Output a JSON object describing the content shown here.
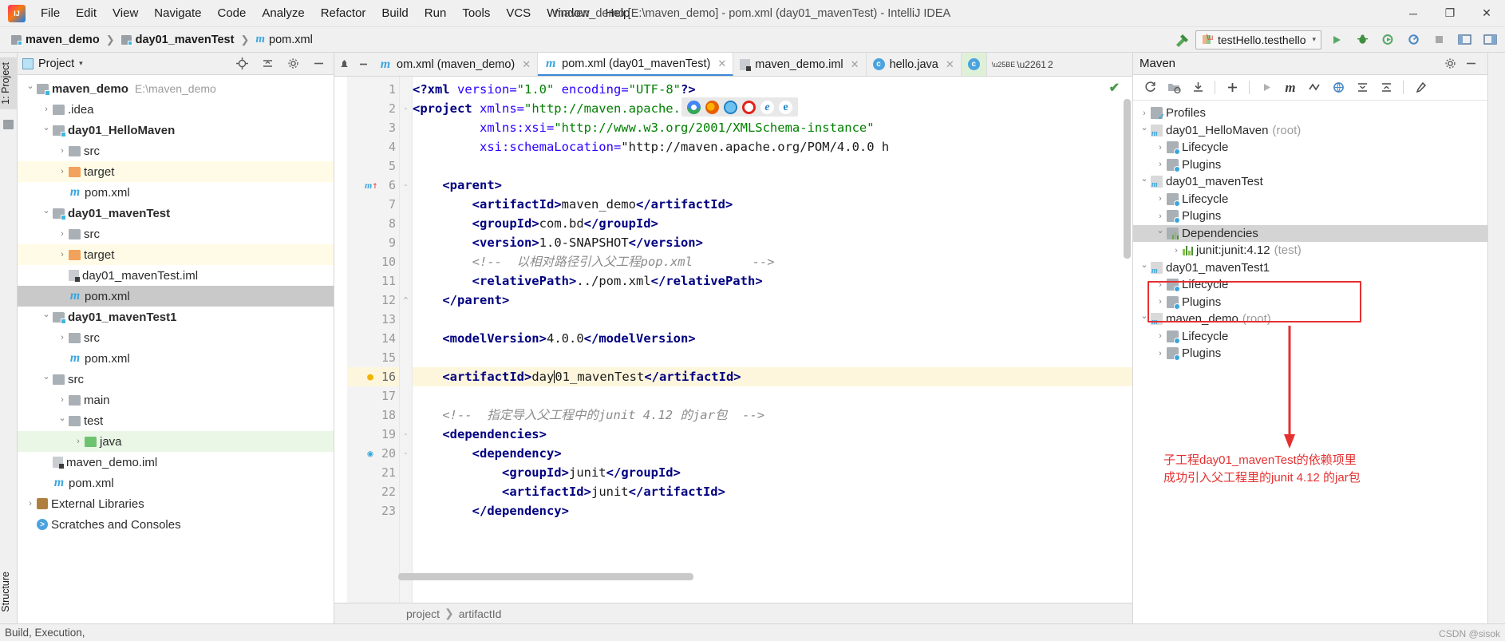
{
  "titlebar": {
    "logo": "intellij-logo",
    "menus": [
      "File",
      "Edit",
      "View",
      "Navigate",
      "Code",
      "Analyze",
      "Refactor",
      "Build",
      "Run",
      "Tools",
      "VCS",
      "Window",
      "Help"
    ],
    "window_title": "maven_demo [E:\\maven_demo] - pom.xml (day01_mavenTest) - IntelliJ IDEA",
    "minimize": "─",
    "maximize": "❐",
    "close": "✕"
  },
  "navbar": {
    "breadcrumb": [
      "maven_demo",
      "day01_mavenTest",
      "pom.xml"
    ],
    "separator": "❯",
    "run_config": "testHello.testhello",
    "run_config_chevron": "▾",
    "buttons": [
      "run",
      "debug",
      "run-with-coverage",
      "profile",
      "stop",
      "ui-inspector",
      "layout"
    ]
  },
  "left_rail": {
    "project_tab": "1: Project",
    "structure_tab": "Structure"
  },
  "project_panel": {
    "title": "Project",
    "title_chevron": "▾",
    "toolbar_icons": [
      "locate-icon",
      "collapse-all-icon",
      "settings-icon",
      "hide-icon"
    ],
    "tree": [
      {
        "depth": 0,
        "arrow": "open",
        "icon": "module",
        "label": "maven_demo",
        "bold": true,
        "path": "E:\\maven_demo",
        "hl": "none"
      },
      {
        "depth": 1,
        "arrow": "closed",
        "icon": "folder",
        "label": ".idea",
        "bold": false,
        "hl": "none"
      },
      {
        "depth": 1,
        "arrow": "open",
        "icon": "module",
        "label": "day01_HelloMaven",
        "bold": true,
        "hl": "none"
      },
      {
        "depth": 2,
        "arrow": "closed",
        "icon": "folder",
        "label": "src",
        "bold": false,
        "hl": "none"
      },
      {
        "depth": 2,
        "arrow": "closed",
        "icon": "folder-orange",
        "label": "target",
        "bold": false,
        "hl": "yellow"
      },
      {
        "depth": 2,
        "arrow": "none",
        "icon": "maven",
        "label": "pom.xml",
        "bold": false,
        "hl": "none"
      },
      {
        "depth": 1,
        "arrow": "open",
        "icon": "module",
        "label": "day01_mavenTest",
        "bold": true,
        "hl": "none"
      },
      {
        "depth": 2,
        "arrow": "closed",
        "icon": "folder",
        "label": "src",
        "bold": false,
        "hl": "none"
      },
      {
        "depth": 2,
        "arrow": "closed",
        "icon": "folder-orange",
        "label": "target",
        "bold": false,
        "hl": "yellow"
      },
      {
        "depth": 2,
        "arrow": "none",
        "icon": "iml",
        "label": "day01_mavenTest.iml",
        "bold": false,
        "hl": "none"
      },
      {
        "depth": 2,
        "arrow": "none",
        "icon": "maven",
        "label": "pom.xml",
        "bold": false,
        "hl": "gray"
      },
      {
        "depth": 1,
        "arrow": "open",
        "icon": "module",
        "label": "day01_mavenTest1",
        "bold": true,
        "hl": "none"
      },
      {
        "depth": 2,
        "arrow": "closed",
        "icon": "folder",
        "label": "src",
        "bold": false,
        "hl": "none"
      },
      {
        "depth": 2,
        "arrow": "none",
        "icon": "maven",
        "label": "pom.xml",
        "bold": false,
        "hl": "none"
      },
      {
        "depth": 1,
        "arrow": "open",
        "icon": "folder",
        "label": "src",
        "bold": false,
        "hl": "none"
      },
      {
        "depth": 2,
        "arrow": "closed",
        "icon": "folder",
        "label": "main",
        "bold": false,
        "hl": "none"
      },
      {
        "depth": 2,
        "arrow": "open",
        "icon": "folder",
        "label": "test",
        "bold": false,
        "hl": "none"
      },
      {
        "depth": 3,
        "arrow": "closed",
        "icon": "folder-green",
        "label": "java",
        "bold": false,
        "hl": "green"
      },
      {
        "depth": 1,
        "arrow": "none",
        "icon": "iml",
        "label": "maven_demo.iml",
        "bold": false,
        "hl": "none"
      },
      {
        "depth": 1,
        "arrow": "none",
        "icon": "maven",
        "label": "pom.xml",
        "bold": false,
        "hl": "none"
      },
      {
        "depth": 0,
        "arrow": "closed",
        "icon": "library",
        "label": "External Libraries",
        "bold": false,
        "hl": "none"
      },
      {
        "depth": 0,
        "arrow": "none",
        "icon": "console",
        "label": "Scratches and Consoles",
        "bold": false,
        "hl": "none"
      }
    ]
  },
  "editor": {
    "tabs": [
      {
        "icon": "maven",
        "label": "om.xml (maven_demo)",
        "active": false,
        "close": "✕"
      },
      {
        "icon": "maven",
        "label": "pom.xml (day01_mavenTest)",
        "active": true,
        "close": "✕"
      },
      {
        "icon": "iml",
        "label": "maven_demo.iml",
        "active": false,
        "close": "✕"
      },
      {
        "icon": "java",
        "label": "hello.java",
        "active": false,
        "close": "✕"
      },
      {
        "icon": "java",
        "label": "",
        "active": false,
        "close": ""
      }
    ],
    "tab_overflow": "2",
    "browser_icons": [
      "chrome-icon",
      "firefox-icon",
      "safari-icon",
      "opera-icon",
      "ie-icon",
      "edge-icon"
    ],
    "inspection_ok": "✔",
    "lines": [
      {
        "n": 1,
        "mark": "",
        "fold": "",
        "cur": false
      },
      {
        "n": 2,
        "mark": "",
        "fold": "-",
        "cur": false
      },
      {
        "n": 3,
        "mark": "",
        "fold": "",
        "cur": false
      },
      {
        "n": 4,
        "mark": "",
        "fold": "",
        "cur": false
      },
      {
        "n": 5,
        "mark": "",
        "fold": "",
        "cur": false
      },
      {
        "n": 6,
        "mark": "m",
        "fold": "-",
        "cur": false
      },
      {
        "n": 7,
        "mark": "",
        "fold": "",
        "cur": false
      },
      {
        "n": 8,
        "mark": "",
        "fold": "",
        "cur": false
      },
      {
        "n": 9,
        "mark": "",
        "fold": "",
        "cur": false
      },
      {
        "n": 10,
        "mark": "",
        "fold": "",
        "cur": false
      },
      {
        "n": 11,
        "mark": "",
        "fold": "",
        "cur": false
      },
      {
        "n": 12,
        "mark": "",
        "fold": "⌃",
        "cur": false
      },
      {
        "n": 13,
        "mark": "",
        "fold": "",
        "cur": false
      },
      {
        "n": 14,
        "mark": "",
        "fold": "",
        "cur": false
      },
      {
        "n": 15,
        "mark": "",
        "fold": "",
        "cur": false
      },
      {
        "n": 16,
        "mark": "💡",
        "fold": "",
        "cur": true
      },
      {
        "n": 17,
        "mark": "",
        "fold": "",
        "cur": false
      },
      {
        "n": 18,
        "mark": "",
        "fold": "",
        "cur": false
      },
      {
        "n": 19,
        "mark": "",
        "fold": "-",
        "cur": false
      },
      {
        "n": 20,
        "mark": "o",
        "fold": "-",
        "cur": false
      },
      {
        "n": 21,
        "mark": "",
        "fold": "",
        "cur": false
      },
      {
        "n": 22,
        "mark": "",
        "fold": "",
        "cur": false
      },
      {
        "n": 23,
        "mark": "",
        "fold": "",
        "cur": false
      }
    ],
    "code_text": [
      "<?xml version=\"1.0\" encoding=\"UTF-8\"?>",
      "<project xmlns=\"http://maven.apache.org/POM/4.0.0\"",
      "         xmlns:xsi=\"http://www.w3.org/2001/XMLSchema-instance\"",
      "         xsi:schemaLocation=\"http://maven.apache.org/POM/4.0.0 h",
      "",
      "    <parent>",
      "        <artifactId>maven_demo</artifactId>",
      "        <groupId>com.bd</groupId>",
      "        <version>1.0-SNAPSHOT</version>",
      "        <!--  以相对路径引入父工程pop.xml        -->",
      "        <relativePath>../pom.xml</relativePath>",
      "    </parent>",
      "",
      "    <modelVersion>4.0.0</modelVersion>",
      "",
      "    <artifactId>day01_mavenTest</artifactId>",
      "",
      "    <!--  指定导入父工程中的junit 4.12 的jar包  -->",
      "    <dependencies>",
      "        <dependency>",
      "            <groupId>junit</groupId>",
      "            <artifactId>junit</artifactId>",
      "        </dependency>"
    ],
    "breadcrumb_bottom": [
      "project",
      "artifactId"
    ],
    "breadcrumb_bottom_sep": "❯"
  },
  "maven_panel": {
    "title": "Maven",
    "header_icons": [
      "settings-icon",
      "hide-icon"
    ],
    "toolbar_icons": [
      "reimport-icon",
      "generate-sources-icon",
      "download-sources-icon",
      "add-icon",
      "run-icon",
      "maven-m-icon",
      "toggle-skip-tests-icon",
      "offline-icon",
      "expand-all-icon",
      "collapse-all-icon",
      "settings-icon"
    ],
    "tree": [
      {
        "depth": 0,
        "arrow": "closed",
        "icon": "profiles",
        "label": "Profiles",
        "bold": false,
        "suffix": "",
        "sel": false
      },
      {
        "depth": 0,
        "arrow": "open",
        "icon": "pom",
        "label": "day01_HelloMaven",
        "bold": false,
        "suffix": "(root)",
        "sel": false
      },
      {
        "depth": 1,
        "arrow": "closed",
        "icon": "gearfolder",
        "label": "Lifecycle",
        "bold": false,
        "suffix": "",
        "sel": false
      },
      {
        "depth": 1,
        "arrow": "closed",
        "icon": "gearfolder",
        "label": "Plugins",
        "bold": false,
        "suffix": "",
        "sel": false
      },
      {
        "depth": 0,
        "arrow": "open",
        "icon": "pom",
        "label": "day01_mavenTest",
        "bold": false,
        "suffix": "",
        "sel": false
      },
      {
        "depth": 1,
        "arrow": "closed",
        "icon": "gearfolder",
        "label": "Lifecycle",
        "bold": false,
        "suffix": "",
        "sel": false
      },
      {
        "depth": 1,
        "arrow": "closed",
        "icon": "gearfolder",
        "label": "Plugins",
        "bold": false,
        "suffix": "",
        "sel": false
      },
      {
        "depth": 1,
        "arrow": "open",
        "icon": "deps",
        "label": "Dependencies",
        "bold": false,
        "suffix": "",
        "sel": true
      },
      {
        "depth": 2,
        "arrow": "closed",
        "icon": "bars",
        "label": "junit:junit:4.12",
        "bold": false,
        "suffix": "(test)",
        "sel": false
      },
      {
        "depth": 0,
        "arrow": "open",
        "icon": "pom",
        "label": "day01_mavenTest1",
        "bold": false,
        "suffix": "",
        "sel": false
      },
      {
        "depth": 1,
        "arrow": "closed",
        "icon": "gearfolder",
        "label": "Lifecycle",
        "bold": false,
        "suffix": "",
        "sel": false
      },
      {
        "depth": 1,
        "arrow": "closed",
        "icon": "gearfolder",
        "label": "Plugins",
        "bold": false,
        "suffix": "",
        "sel": false
      },
      {
        "depth": 0,
        "arrow": "open",
        "icon": "pom",
        "label": "maven_demo",
        "bold": false,
        "suffix": "(root)",
        "sel": false
      },
      {
        "depth": 1,
        "arrow": "closed",
        "icon": "gearfolder",
        "label": "Lifecycle",
        "bold": false,
        "suffix": "",
        "sel": false
      },
      {
        "depth": 1,
        "arrow": "closed",
        "icon": "gearfolder",
        "label": "Plugins",
        "bold": false,
        "suffix": "",
        "sel": false
      }
    ],
    "annotation_line1": "子工程day01_mavenTest的依赖项里",
    "annotation_line2": "成功引入父工程里的junit 4.12 的jar包",
    "annotation_color": "#e53030"
  },
  "statusbar": {
    "left_text": "Build, Execution,",
    "watermark": "CSDN @sisok"
  }
}
